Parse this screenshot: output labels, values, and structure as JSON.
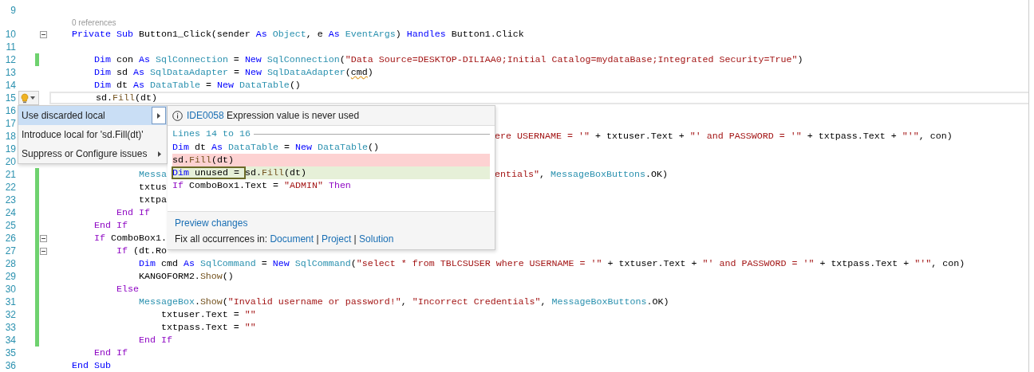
{
  "editor": {
    "lines": [
      {
        "number": "9",
        "changed": false,
        "foldable": false,
        "current": false
      },
      {
        "number": "10",
        "changed": false,
        "foldable": true,
        "current": false,
        "lens": "0 references",
        "tokens": [
          {
            "kind": "kw",
            "text": "Private Sub "
          },
          {
            "kind": "id",
            "text": "Button1_Click(sender "
          },
          {
            "kind": "kw",
            "text": "As "
          },
          {
            "kind": "type",
            "text": "Object"
          },
          {
            "kind": "id",
            "text": ", e "
          },
          {
            "kind": "kw",
            "text": "As "
          },
          {
            "kind": "type",
            "text": "EventArgs"
          },
          {
            "kind": "id",
            "text": ") "
          },
          {
            "kind": "kw",
            "text": "Handles "
          },
          {
            "kind": "id",
            "text": "Button1.Click"
          }
        ],
        "children": [
          {
            "number": "11",
            "changed": false,
            "foldable": false,
            "current": false
          },
          {
            "number": "12",
            "changed": true,
            "foldable": false,
            "current": false,
            "tokens": [
              {
                "kind": "kw",
                "text": "Dim "
              },
              {
                "kind": "id",
                "text": "con "
              },
              {
                "kind": "kw",
                "text": "As "
              },
              {
                "kind": "type",
                "text": "SqlConnection"
              },
              {
                "kind": "id",
                "text": " = "
              },
              {
                "kind": "kw",
                "text": "New "
              },
              {
                "kind": "type",
                "text": "SqlConnection"
              },
              {
                "kind": "id",
                "text": "("
              },
              {
                "kind": "str",
                "text": "\"Data Source=DESKTOP-DILIAA0;Initial Catalog=mydataBase;Integrated Security=True\""
              },
              {
                "kind": "id",
                "text": ")"
              }
            ]
          },
          {
            "number": "13",
            "changed": false,
            "foldable": false,
            "current": false,
            "tokens": [
              {
                "kind": "kw",
                "text": "Dim "
              },
              {
                "kind": "id",
                "text": "sd "
              },
              {
                "kind": "kw",
                "text": "As "
              },
              {
                "kind": "type",
                "text": "SqlDataAdapter"
              },
              {
                "kind": "id",
                "text": " = "
              },
              {
                "kind": "kw",
                "text": "New "
              },
              {
                "kind": "type",
                "text": "SqlDataAdapter"
              },
              {
                "kind": "id",
                "text": "("
              },
              {
                "kind": "error",
                "text": "cmd"
              },
              {
                "kind": "id",
                "text": ")"
              }
            ]
          },
          {
            "number": "14",
            "changed": false,
            "foldable": false,
            "current": false,
            "tokens": [
              {
                "kind": "kw",
                "text": "Dim "
              },
              {
                "kind": "id",
                "text": "dt "
              },
              {
                "kind": "kw",
                "text": "As "
              },
              {
                "kind": "type",
                "text": "DataTable"
              },
              {
                "kind": "id",
                "text": " = "
              },
              {
                "kind": "kw",
                "text": "New "
              },
              {
                "kind": "type",
                "text": "DataTable"
              },
              {
                "kind": "id",
                "text": "()"
              }
            ]
          },
          {
            "number": "15",
            "changed": false,
            "foldable": false,
            "current": true,
            "lightbulb": true,
            "tokens": [
              {
                "kind": "id",
                "text": "sd."
              },
              {
                "kind": "fn",
                "text": "Fill"
              },
              {
                "kind": "id",
                "text": "(dt)"
              }
            ]
          },
          {
            "number": "16",
            "changed": false,
            "foldable": false,
            "current": false,
            "children": [
              {
                "number": "17",
                "changed": false,
                "foldable": false,
                "current": false,
                "children": [
                  {
                    "number": "18",
                    "changed": false,
                    "foldable": false,
                    "current": false,
                    "after_popup": [
                      {
                        "kind": "str",
                        "text": "ere USERNAME = '\""
                      },
                      {
                        "kind": "id",
                        "text": " + txtuser.Text + "
                      },
                      {
                        "kind": "str",
                        "text": "\"' and PASSWORD = '\""
                      },
                      {
                        "kind": "id",
                        "text": " + txtpass.Text + "
                      },
                      {
                        "kind": "str",
                        "text": "\"'\""
                      },
                      {
                        "kind": "id",
                        "text": ", con)"
                      }
                    ]
                  },
                  {
                    "number": "19",
                    "changed": false,
                    "foldable": false,
                    "current": false
                  },
                  {
                    "number": "20",
                    "changed": false,
                    "foldable": false,
                    "current": false
                  },
                  {
                    "number": "21",
                    "changed": true,
                    "foldable": false,
                    "current": false,
                    "tokens": [
                      {
                        "kind": "type",
                        "text": "Messa"
                      }
                    ],
                    "after_popup": [
                      {
                        "kind": "str",
                        "text": "entials\""
                      },
                      {
                        "kind": "id",
                        "text": ", "
                      },
                      {
                        "kind": "type",
                        "text": "MessageBoxButtons"
                      },
                      {
                        "kind": "id",
                        "text": ".OK)"
                      }
                    ]
                  },
                  {
                    "number": "22",
                    "changed": true,
                    "foldable": false,
                    "current": false,
                    "tokens": [
                      {
                        "kind": "id",
                        "text": "txtus"
                      }
                    ]
                  },
                  {
                    "number": "23",
                    "changed": true,
                    "foldable": false,
                    "current": false,
                    "tokens": [
                      {
                        "kind": "id",
                        "text": "txtpa"
                      }
                    ]
                  }
                ]
              },
              {
                "number": "24",
                "changed": true,
                "foldable": false,
                "current": false,
                "tokens": [
                  {
                    "kind": "ctl",
                    "text": "End If"
                  }
                ]
              }
            ]
          },
          {
            "number": "25",
            "changed": true,
            "foldable": false,
            "current": false,
            "tokens": [
              {
                "kind": "ctl",
                "text": "End If"
              }
            ]
          },
          {
            "number": "26",
            "changed": true,
            "foldable": true,
            "current": false,
            "tokens": [
              {
                "kind": "ctl",
                "text": "If "
              },
              {
                "kind": "id",
                "text": "ComboBox1."
              }
            ],
            "children": [
              {
                "number": "27",
                "changed": true,
                "foldable": true,
                "current": false,
                "tokens": [
                  {
                    "kind": "ctl",
                    "text": "If "
                  },
                  {
                    "kind": "id",
                    "text": "(dt.Ro"
                  }
                ],
                "children": [
                  {
                    "number": "28",
                    "changed": true,
                    "foldable": false,
                    "current": false,
                    "tokens": [
                      {
                        "kind": "kw",
                        "text": "Dim "
                      },
                      {
                        "kind": "id",
                        "text": "cmd "
                      },
                      {
                        "kind": "kw",
                        "text": "As "
                      },
                      {
                        "kind": "type",
                        "text": "SqlCommand"
                      },
                      {
                        "kind": "id",
                        "text": " = "
                      },
                      {
                        "kind": "kw",
                        "text": "New "
                      },
                      {
                        "kind": "type",
                        "text": "SqlCommand"
                      },
                      {
                        "kind": "id",
                        "text": "("
                      },
                      {
                        "kind": "str",
                        "text": "\"select * from TBLCSUSER where USERNAME = '\""
                      },
                      {
                        "kind": "id",
                        "text": " + txtuser.Text + "
                      },
                      {
                        "kind": "str",
                        "text": "\"' and PASSWORD = '\""
                      },
                      {
                        "kind": "id",
                        "text": " + txtpass.Text + "
                      },
                      {
                        "kind": "str",
                        "text": "\"'\""
                      },
                      {
                        "kind": "id",
                        "text": ", con)"
                      }
                    ]
                  },
                  {
                    "number": "29",
                    "changed": true,
                    "foldable": false,
                    "current": false,
                    "tokens": [
                      {
                        "kind": "id",
                        "text": "KANGOFORM2."
                      },
                      {
                        "kind": "fn",
                        "text": "Show"
                      },
                      {
                        "kind": "id",
                        "text": "()"
                      }
                    ]
                  }
                ]
              },
              {
                "number": "30",
                "changed": true,
                "foldable": false,
                "current": false,
                "tokens": [
                  {
                    "kind": "ctl",
                    "text": "Else"
                  }
                ],
                "children": [
                  {
                    "number": "31",
                    "changed": true,
                    "foldable": false,
                    "current": false,
                    "tokens": [
                      {
                        "kind": "type",
                        "text": "MessageBox"
                      },
                      {
                        "kind": "id",
                        "text": "."
                      },
                      {
                        "kind": "fn",
                        "text": "Show"
                      },
                      {
                        "kind": "id",
                        "text": "("
                      },
                      {
                        "kind": "str",
                        "text": "\"Invalid username or password!\""
                      },
                      {
                        "kind": "id",
                        "text": ", "
                      },
                      {
                        "kind": "str",
                        "text": "\"Incorrect Credentials\""
                      },
                      {
                        "kind": "id",
                        "text": ", "
                      },
                      {
                        "kind": "type",
                        "text": "MessageBoxButtons"
                      },
                      {
                        "kind": "id",
                        "text": ".OK)"
                      }
                    ],
                    "children": [
                      {
                        "number": "32",
                        "changed": true,
                        "foldable": false,
                        "current": false,
                        "tokens": [
                          {
                            "kind": "id",
                            "text": "txtuser.Text = "
                          },
                          {
                            "kind": "str",
                            "text": "\"\""
                          }
                        ]
                      },
                      {
                        "number": "33",
                        "changed": true,
                        "foldable": false,
                        "current": false,
                        "tokens": [
                          {
                            "kind": "id",
                            "text": "txtpass.Text = "
                          },
                          {
                            "kind": "str",
                            "text": "\"\""
                          }
                        ]
                      }
                    ]
                  },
                  {
                    "number": "34",
                    "changed": true,
                    "foldable": false,
                    "current": false,
                    "tokens": [
                      {
                        "kind": "ctl",
                        "text": "End If"
                      }
                    ]
                  }
                ]
              }
            ]
          },
          {
            "number": "35",
            "changed": false,
            "foldable": false,
            "current": false,
            "tokens": [
              {
                "kind": "ctl",
                "text": "End If"
              }
            ]
          }
        ]
      },
      {
        "number": "36",
        "changed": false,
        "foldable": false,
        "current": false,
        "tokens": [
          {
            "kind": "kw",
            "text": "End Sub"
          }
        ]
      }
    ]
  },
  "quick_actions": {
    "menu": [
      {
        "label": "Use discarded local",
        "selected": true,
        "submenu": true
      },
      {
        "label": "Introduce local for 'sd.Fill(dt)'",
        "selected": false,
        "submenu": false
      },
      {
        "label": "Suppress or Configure issues",
        "selected": false,
        "submenu": true
      }
    ],
    "preview": {
      "diagnostic_id": "IDE0058",
      "message": "Expression value is never used",
      "range": "Lines 14 to 16",
      "lines": [
        {
          "kind": "context",
          "tokens": [
            {
              "kind": "kw",
              "text": "Dim "
            },
            {
              "kind": "id",
              "text": "dt "
            },
            {
              "kind": "kw",
              "text": "As "
            },
            {
              "kind": "type",
              "text": "DataTable"
            },
            {
              "kind": "id",
              "text": " = "
            },
            {
              "kind": "kw",
              "text": "New "
            },
            {
              "kind": "type",
              "text": "DataTable"
            },
            {
              "kind": "id",
              "text": "()"
            }
          ]
        },
        {
          "kind": "removed",
          "tokens": [
            {
              "kind": "id",
              "text": "sd."
            },
            {
              "kind": "fn",
              "text": "Fill"
            },
            {
              "kind": "id",
              "text": "(dt)"
            }
          ]
        },
        {
          "kind": "added",
          "inserted": [
            {
              "kind": "kw",
              "text": "Dim "
            },
            {
              "kind": "id",
              "text": "unused = "
            }
          ],
          "tokens": [
            {
              "kind": "id",
              "text": "sd."
            },
            {
              "kind": "fn",
              "text": "Fill"
            },
            {
              "kind": "id",
              "text": "(dt)"
            }
          ]
        },
        {
          "kind": "context",
          "tokens": [
            {
              "kind": "ctl",
              "text": "If "
            },
            {
              "kind": "id",
              "text": "ComboBox1.Text = "
            },
            {
              "kind": "str",
              "text": "\"ADMIN\""
            },
            {
              "kind": "ctl",
              "text": " Then"
            }
          ]
        }
      ],
      "preview_link": "Preview changes",
      "fix_all_label": "Fix all occurrences in:",
      "fix_all_links": [
        "Document",
        "Project",
        "Solution"
      ],
      "separator": "|"
    }
  }
}
